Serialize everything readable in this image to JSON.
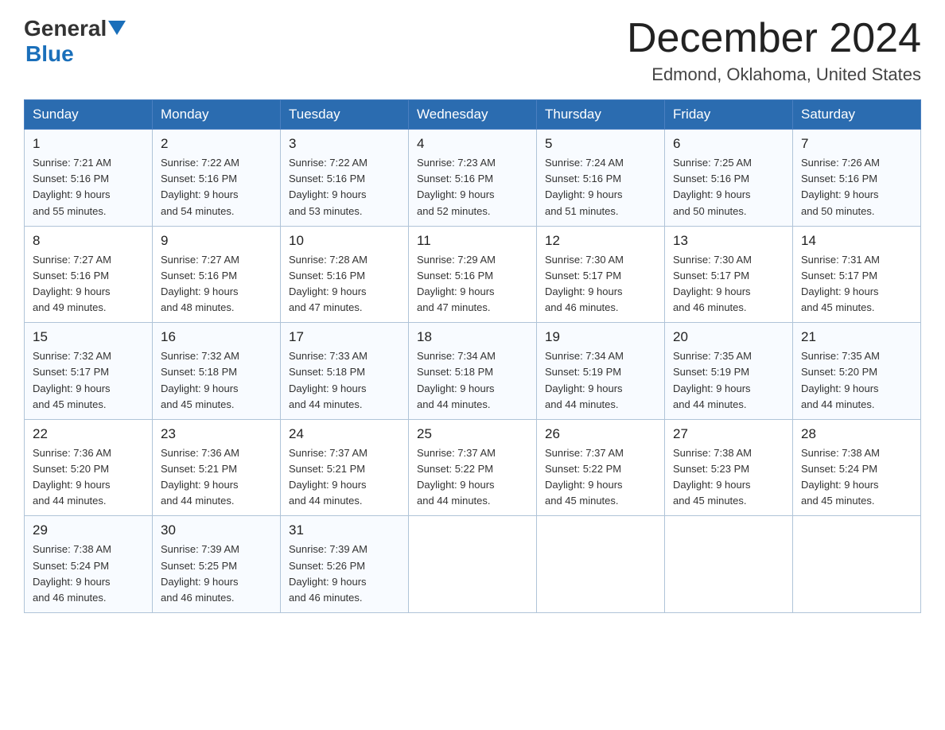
{
  "header": {
    "logo_general": "General",
    "logo_blue": "Blue",
    "month_title": "December 2024",
    "location": "Edmond, Oklahoma, United States"
  },
  "days_of_week": [
    "Sunday",
    "Monday",
    "Tuesday",
    "Wednesday",
    "Thursday",
    "Friday",
    "Saturday"
  ],
  "weeks": [
    [
      {
        "day": "1",
        "sunrise": "7:21 AM",
        "sunset": "5:16 PM",
        "daylight": "9 hours and 55 minutes."
      },
      {
        "day": "2",
        "sunrise": "7:22 AM",
        "sunset": "5:16 PM",
        "daylight": "9 hours and 54 minutes."
      },
      {
        "day": "3",
        "sunrise": "7:22 AM",
        "sunset": "5:16 PM",
        "daylight": "9 hours and 53 minutes."
      },
      {
        "day": "4",
        "sunrise": "7:23 AM",
        "sunset": "5:16 PM",
        "daylight": "9 hours and 52 minutes."
      },
      {
        "day": "5",
        "sunrise": "7:24 AM",
        "sunset": "5:16 PM",
        "daylight": "9 hours and 51 minutes."
      },
      {
        "day": "6",
        "sunrise": "7:25 AM",
        "sunset": "5:16 PM",
        "daylight": "9 hours and 50 minutes."
      },
      {
        "day": "7",
        "sunrise": "7:26 AM",
        "sunset": "5:16 PM",
        "daylight": "9 hours and 50 minutes."
      }
    ],
    [
      {
        "day": "8",
        "sunrise": "7:27 AM",
        "sunset": "5:16 PM",
        "daylight": "9 hours and 49 minutes."
      },
      {
        "day": "9",
        "sunrise": "7:27 AM",
        "sunset": "5:16 PM",
        "daylight": "9 hours and 48 minutes."
      },
      {
        "day": "10",
        "sunrise": "7:28 AM",
        "sunset": "5:16 PM",
        "daylight": "9 hours and 47 minutes."
      },
      {
        "day": "11",
        "sunrise": "7:29 AM",
        "sunset": "5:16 PM",
        "daylight": "9 hours and 47 minutes."
      },
      {
        "day": "12",
        "sunrise": "7:30 AM",
        "sunset": "5:17 PM",
        "daylight": "9 hours and 46 minutes."
      },
      {
        "day": "13",
        "sunrise": "7:30 AM",
        "sunset": "5:17 PM",
        "daylight": "9 hours and 46 minutes."
      },
      {
        "day": "14",
        "sunrise": "7:31 AM",
        "sunset": "5:17 PM",
        "daylight": "9 hours and 45 minutes."
      }
    ],
    [
      {
        "day": "15",
        "sunrise": "7:32 AM",
        "sunset": "5:17 PM",
        "daylight": "9 hours and 45 minutes."
      },
      {
        "day": "16",
        "sunrise": "7:32 AM",
        "sunset": "5:18 PM",
        "daylight": "9 hours and 45 minutes."
      },
      {
        "day": "17",
        "sunrise": "7:33 AM",
        "sunset": "5:18 PM",
        "daylight": "9 hours and 44 minutes."
      },
      {
        "day": "18",
        "sunrise": "7:34 AM",
        "sunset": "5:18 PM",
        "daylight": "9 hours and 44 minutes."
      },
      {
        "day": "19",
        "sunrise": "7:34 AM",
        "sunset": "5:19 PM",
        "daylight": "9 hours and 44 minutes."
      },
      {
        "day": "20",
        "sunrise": "7:35 AM",
        "sunset": "5:19 PM",
        "daylight": "9 hours and 44 minutes."
      },
      {
        "day": "21",
        "sunrise": "7:35 AM",
        "sunset": "5:20 PM",
        "daylight": "9 hours and 44 minutes."
      }
    ],
    [
      {
        "day": "22",
        "sunrise": "7:36 AM",
        "sunset": "5:20 PM",
        "daylight": "9 hours and 44 minutes."
      },
      {
        "day": "23",
        "sunrise": "7:36 AM",
        "sunset": "5:21 PM",
        "daylight": "9 hours and 44 minutes."
      },
      {
        "day": "24",
        "sunrise": "7:37 AM",
        "sunset": "5:21 PM",
        "daylight": "9 hours and 44 minutes."
      },
      {
        "day": "25",
        "sunrise": "7:37 AM",
        "sunset": "5:22 PM",
        "daylight": "9 hours and 44 minutes."
      },
      {
        "day": "26",
        "sunrise": "7:37 AM",
        "sunset": "5:22 PM",
        "daylight": "9 hours and 45 minutes."
      },
      {
        "day": "27",
        "sunrise": "7:38 AM",
        "sunset": "5:23 PM",
        "daylight": "9 hours and 45 minutes."
      },
      {
        "day": "28",
        "sunrise": "7:38 AM",
        "sunset": "5:24 PM",
        "daylight": "9 hours and 45 minutes."
      }
    ],
    [
      {
        "day": "29",
        "sunrise": "7:38 AM",
        "sunset": "5:24 PM",
        "daylight": "9 hours and 46 minutes."
      },
      {
        "day": "30",
        "sunrise": "7:39 AM",
        "sunset": "5:25 PM",
        "daylight": "9 hours and 46 minutes."
      },
      {
        "day": "31",
        "sunrise": "7:39 AM",
        "sunset": "5:26 PM",
        "daylight": "9 hours and 46 minutes."
      },
      null,
      null,
      null,
      null
    ]
  ],
  "labels": {
    "sunrise": "Sunrise:",
    "sunset": "Sunset:",
    "daylight": "Daylight:"
  }
}
